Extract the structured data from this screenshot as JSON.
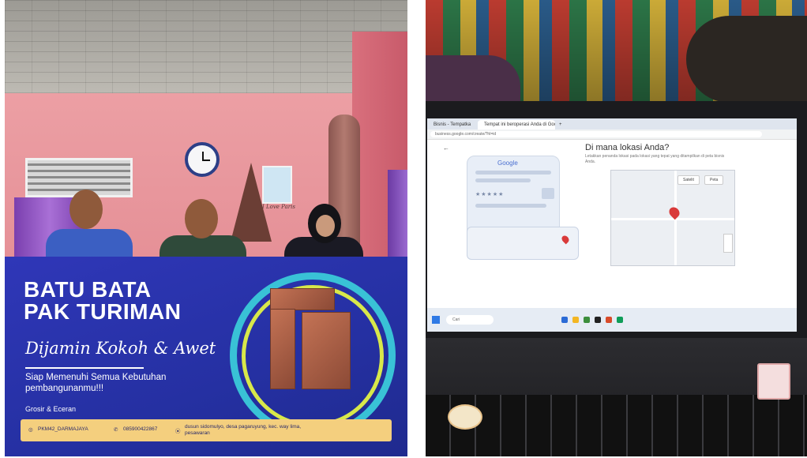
{
  "left_photo": {
    "description_icon": "group-photo-with-banner",
    "wall_sign": "I Love Paris",
    "banner": {
      "title_line1": "BATU BATA",
      "title_line2": "PAK TURIMAN",
      "script": "Dijamin Kokoh & Awet",
      "tagline": "Siap Memenuhi Semua Kebutuhan pembangunanmu!!!",
      "sub": "Grosir & Eceran",
      "footer": {
        "handle": "PKM42_DARMAJAYA",
        "phone": "085900422867",
        "address": "dusun sidomulyo, desa pagaruyung, kec. way lima, pesawaran"
      },
      "colors": {
        "bg": "#2530a2",
        "ring_cyan": "#39c2d6",
        "ring_lime": "#d8e84a",
        "footer": "#f4cf7e"
      }
    }
  },
  "right_photo": {
    "description_icon": "laptop-showing-google-business-profile",
    "browser": {
      "tabs": [
        "Bisnis - Tempatka",
        "Tempat ini beroperasi Anda di Google"
      ],
      "address_text": "business.google.com/create/?hl=id"
    },
    "page": {
      "headline": "Di mana lokasi Anda?",
      "description": "Letakkan penanda lokasi pada lokasi yang tepat yang ditampilkan di peta bisnis Anda.",
      "card_logo": "Google",
      "card_stars": "★★★★★",
      "map_buttons": [
        "Satelit",
        "Peta"
      ]
    },
    "taskbar": {
      "search_placeholder": "Cari"
    }
  }
}
